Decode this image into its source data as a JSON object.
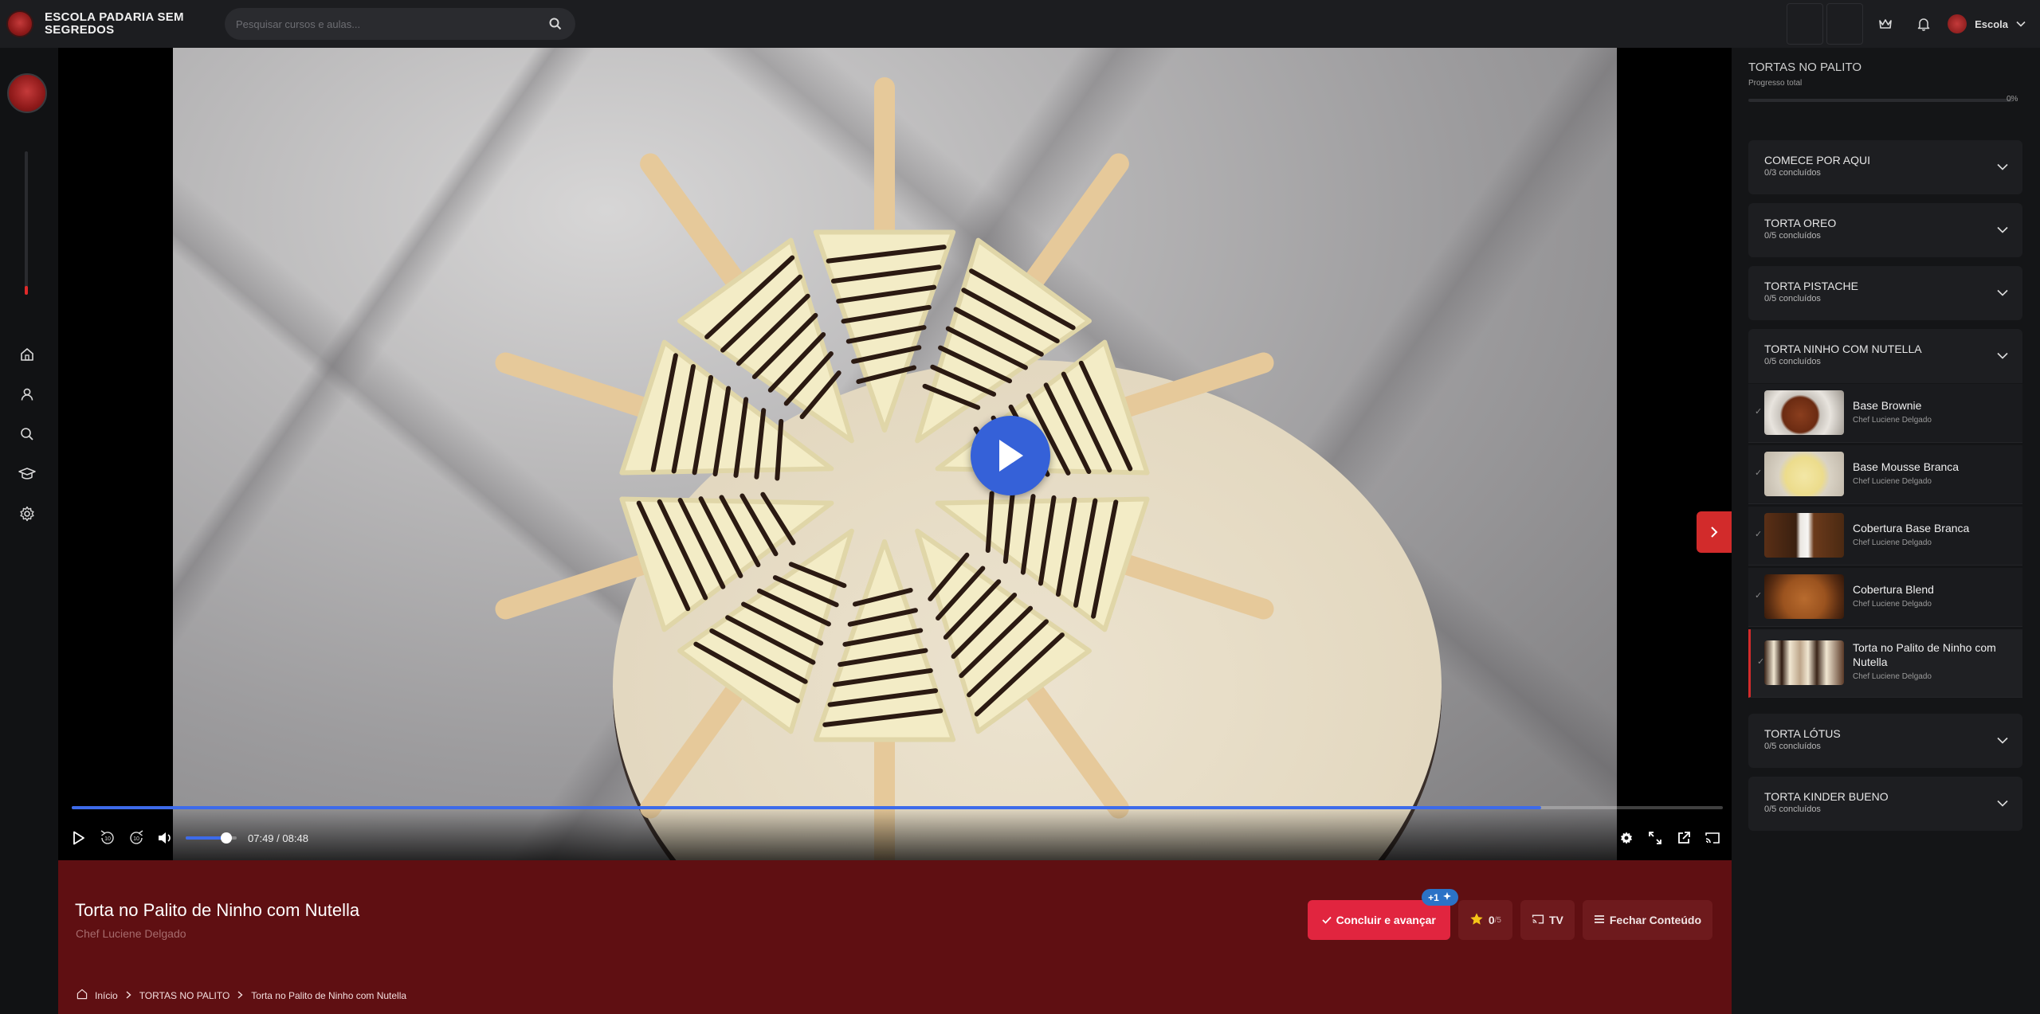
{
  "brand": {
    "name": "ESCOLA PADARIA SEM SEGREDOS"
  },
  "search": {
    "placeholder": "Pesquisar cursos e aulas..."
  },
  "user": {
    "name": "Escola"
  },
  "player": {
    "current_time": "07:49",
    "separator": "/",
    "duration": "08:48",
    "progress": 0.89,
    "volume": 0.8,
    "rewind_label": "10",
    "forward_label": "10"
  },
  "lesson": {
    "title": "Torta no Palito de Ninho com Nutella",
    "author": "Chef Luciene Delgado",
    "complete_label": "Concluir e avançar",
    "xp_badge": "+1",
    "rating_value": "0",
    "rating_max": "/5",
    "tv_label": "TV",
    "close_label": "Fechar Conteúdo"
  },
  "breadcrumb": [
    "Início",
    "TORTAS NO PALITO",
    "Torta no Palito de Ninho com Nutella"
  ],
  "course": {
    "name": "TORTAS NO PALITO",
    "progress_label": "Progresso total",
    "progress_pct": "0%",
    "progress": 0
  },
  "modules": [
    {
      "title": "COMECE POR AQUI",
      "count": "0/3 concluídos"
    },
    {
      "title": "TORTA OREO",
      "count": "0/5 concluídos"
    },
    {
      "title": "TORTA PISTACHE",
      "count": "0/5 concluídos"
    },
    {
      "title": "TORTA NINHO COM NUTELLA",
      "count": "0/5 concluídos"
    },
    {
      "title": "TORTA LÓTUS",
      "count": "0/5 concluídos"
    },
    {
      "title": "TORTA KINDER BUENO",
      "count": "0/5 concluídos"
    }
  ],
  "lessons": [
    {
      "title": "Base Brownie",
      "chef": "Chef Luciene Delgado",
      "check": "✓"
    },
    {
      "title": "Base Mousse Branca",
      "chef": "Chef Luciene Delgado",
      "check": "✓"
    },
    {
      "title": "Cobertura Base Branca",
      "chef": "Chef Luciene Delgado",
      "check": "✓"
    },
    {
      "title": "Cobertura Blend",
      "chef": "Chef Luciene Delgado",
      "check": "✓"
    },
    {
      "title": "Torta no Palito de Ninho com Nutella",
      "chef": "Chef Luciene Delgado",
      "check": "✓"
    }
  ],
  "colors": {
    "accent_blue": "#3561d8",
    "brand_red": "#d22b2b",
    "info_bar": "#5f0f12",
    "primary_button": "#e1253f"
  },
  "icons": {
    "search": "search-icon",
    "crown": "crown-icon",
    "bell": "bell-icon",
    "chevron_down": "chevron-down-icon",
    "home": "home-icon",
    "user": "user-icon",
    "graduation": "graduation-cap-icon",
    "gear": "gear-icon"
  }
}
